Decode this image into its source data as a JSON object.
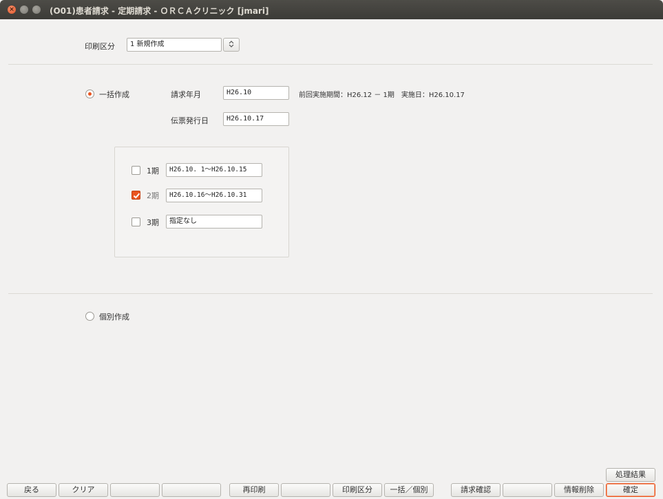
{
  "window": {
    "title": "(O01)患者請求 - 定期請求 - ＯＲＣＡクリニック [jmari]",
    "close_glyph": "×"
  },
  "print_section": {
    "label": "印刷区分",
    "value": "1 新規作成",
    "combo_glyph": "⌃⌄"
  },
  "bulk": {
    "radio_label": "一括作成",
    "radio_selected": true,
    "billing_month_label": "請求年月",
    "billing_month_value": "H26.10",
    "previous_info": "前回実施期間：H26.12 － 1期　実施日：H26.10.17",
    "slip_date_label": "伝票発行日",
    "slip_date_value": "H26.10.17"
  },
  "periods": [
    {
      "label": "1期",
      "value": "H26.10. 1～H26.10.15",
      "checked": false
    },
    {
      "label": "2期",
      "value": "H26.10.16～H26.10.31",
      "checked": true
    },
    {
      "label": "3期",
      "value": "指定なし",
      "checked": false
    }
  ],
  "individual": {
    "radio_label": "個別作成",
    "radio_selected": false
  },
  "result_button": "処理結果",
  "function_keys": [
    {
      "label": "戻る"
    },
    {
      "label": "クリア"
    },
    {
      "label": ""
    },
    {
      "label": ""
    },
    {
      "label": "再印刷"
    },
    {
      "label": ""
    },
    {
      "label": "印刷区分"
    },
    {
      "label": "一括／個別"
    },
    {
      "label": "請求確認"
    },
    {
      "label": ""
    },
    {
      "label": "情報削除"
    },
    {
      "label": "確定"
    }
  ],
  "colors": {
    "accent": "#e95420",
    "titlebar": "#3c3b37",
    "background": "#f2f1f0"
  }
}
